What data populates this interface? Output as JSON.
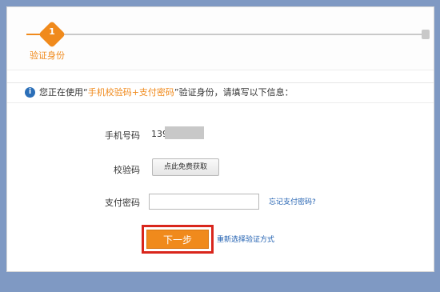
{
  "steps": {
    "current_number": "1",
    "current_label": "验证身份"
  },
  "info": {
    "prefix": "您正在使用“",
    "method": "手机校验码+支付密码",
    "suffix": "”验证身份，请填写以下信息："
  },
  "form": {
    "phone_label": "手机号码",
    "phone_visible_prefix": "139",
    "code_label": "校验码",
    "get_code_button": "点此免费获取",
    "password_label": "支付密码",
    "password_value": "",
    "forgot_password_link": "忘记支付密码?",
    "next_button": "下一步",
    "reselect_link": "重新选择验证方式"
  },
  "colors": {
    "accent": "#f08a1c",
    "link": "#1f5fb0",
    "highlight_frame": "#d9261c",
    "info_icon": "#2b6fb8"
  }
}
